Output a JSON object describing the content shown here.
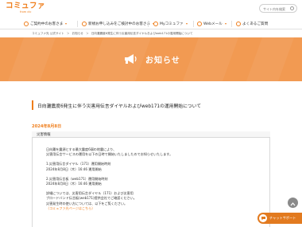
{
  "brand": {
    "logo_text": "コミュファ",
    "logo_sub": "from ctc"
  },
  "header": {
    "search_placeholder": "サイト内を検索"
  },
  "nav": {
    "items": [
      {
        "label": "ご契約中のお客さま"
      },
      {
        "label": "新規お申し込みをご検討中のお客さま"
      },
      {
        "label": "Myコミュファ"
      },
      {
        "label": "Webメール"
      },
      {
        "label": "よくあるご質問"
      }
    ]
  },
  "breadcrumb": {
    "items": [
      "コミュファ光 公式サイト",
      "＞",
      "お知らせ",
      "＞",
      "日向灘震度6発生に伴う災害用伝言ダイヤルおよびweb171の運用開始について"
    ]
  },
  "hero": {
    "title": "お知らせ"
  },
  "notice": {
    "title": "日向灘震度6発生に伴う災害用伝言ダイヤルおよびweb171の運用開始について",
    "date": "2024年8月8日",
    "tab_label": "災害情報",
    "body": [
      "日向灘を震源とする最大震度6弱の地震により、",
      "災害用伝言サービスの運用を以下の日時で開始いたしましたのでお知らせいたします。",
      "",
      "1.災害用伝言ダイヤル（171）運用開始時刻",
      "2024年8月8日（木）16:46 運用開始",
      "",
      "2.災害用伝言板（web171）運用開始時刻",
      "2024年8月8日（木）16:46 運用開始",
      "",
      "詳細については、災害用伝言ダイヤル（171）および災害用",
      "ブロードバンド伝言板(web171)提供会社でご確認ください。",
      "災害発生時の使い方については、以下をご覧ください。"
    ],
    "link_text": "（コミュファ光ページはこちら）"
  },
  "chat": {
    "label": "チャットサポート"
  },
  "colors": {
    "brand_orange": "#ef7d1a",
    "hero_orange": "#f29a52"
  }
}
